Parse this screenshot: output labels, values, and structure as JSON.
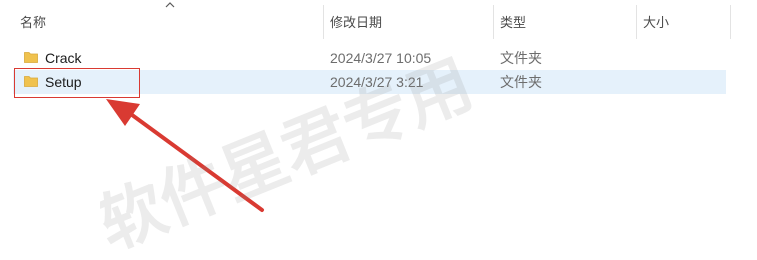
{
  "columns": {
    "name": "名称",
    "date_modified": "修改日期",
    "type": "类型",
    "size": "大小"
  },
  "files": [
    {
      "name": "Crack",
      "date_modified": "2024/3/27 10:05",
      "type": "文件夹",
      "size": ""
    },
    {
      "name": "Setup",
      "date_modified": "2024/3/27 3:21",
      "type": "文件夹",
      "size": ""
    }
  ],
  "watermark": "软件星君专用",
  "colors": {
    "selected_row": "#e5f1fb",
    "annotation_red": "#d93a32",
    "folder_yellow": "#f0c24e"
  },
  "icons": {
    "sort": "chevron-up-icon",
    "folder": "folder-icon"
  }
}
